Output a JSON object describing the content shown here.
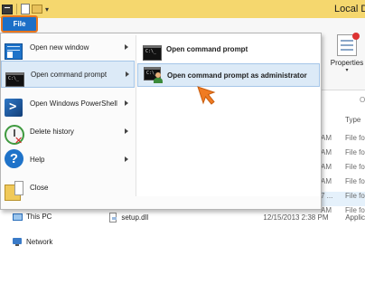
{
  "titlebar": {
    "title": "Local D",
    "qat_arrow": "▾"
  },
  "ribbon": {
    "properties_label": "Properties",
    "properties_caret": "▾",
    "overflow_fragment": "O"
  },
  "file_tab": {
    "label": "File"
  },
  "file_menu": {
    "items": [
      {
        "label": "Open new window",
        "icon": "new-window-icon",
        "has_submenu": true
      },
      {
        "label": "Open command prompt",
        "icon": "command-prompt-icon",
        "has_submenu": true
      },
      {
        "label": "Open Windows PowerShell",
        "icon": "powershell-icon",
        "has_submenu": true
      },
      {
        "label": "Delete history",
        "icon": "delete-history-icon",
        "has_submenu": true
      },
      {
        "label": "Help",
        "icon": "help-icon",
        "has_submenu": true
      },
      {
        "label": "Close",
        "icon": "close-window-icon",
        "has_submenu": false
      }
    ],
    "submenu": [
      {
        "label": "Open command prompt",
        "icon": "command-prompt-icon"
      },
      {
        "label": "Open command prompt as administrator",
        "icon": "admin-command-prompt-icon"
      }
    ]
  },
  "file_list": {
    "type_header": "Type",
    "rows": [
      {
        "time": "AM",
        "type": "File fo"
      },
      {
        "time": "AM",
        "type": "File fo"
      },
      {
        "time": "AM",
        "type": "File fo"
      },
      {
        "time": "AM",
        "type": "File fo"
      },
      {
        "time": "7 ...",
        "type": "File fo"
      },
      {
        "time": "AM",
        "type": "File fo"
      }
    ],
    "setup": {
      "name": "setup.dll",
      "date": "12/15/2013 2:38 PM",
      "type": "Applic"
    }
  },
  "nav": {
    "this_pc": "This PC",
    "network": "Network"
  },
  "colors": {
    "titlebar": "#f5d76e",
    "file_tab": "#1c6fc7",
    "highlight_outline": "#e8761e",
    "hover": "#dceaf7",
    "cursor": "#f07b22"
  }
}
